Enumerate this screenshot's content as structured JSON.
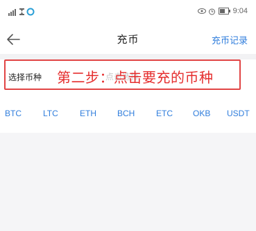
{
  "status": {
    "time": "9:04"
  },
  "nav": {
    "title": "充币",
    "right_link": "充币记录"
  },
  "select": {
    "label": "选择币种",
    "hint": "点击选择",
    "annotation": "第二步：点击要充的币种"
  },
  "coins": [
    "BTC",
    "LTC",
    "ETH",
    "BCH",
    "ETC",
    "OKB",
    "USDT"
  ],
  "colors": {
    "accent": "#2f7ddc",
    "annotation": "#e52d2d",
    "background": "#f5f5f7"
  }
}
